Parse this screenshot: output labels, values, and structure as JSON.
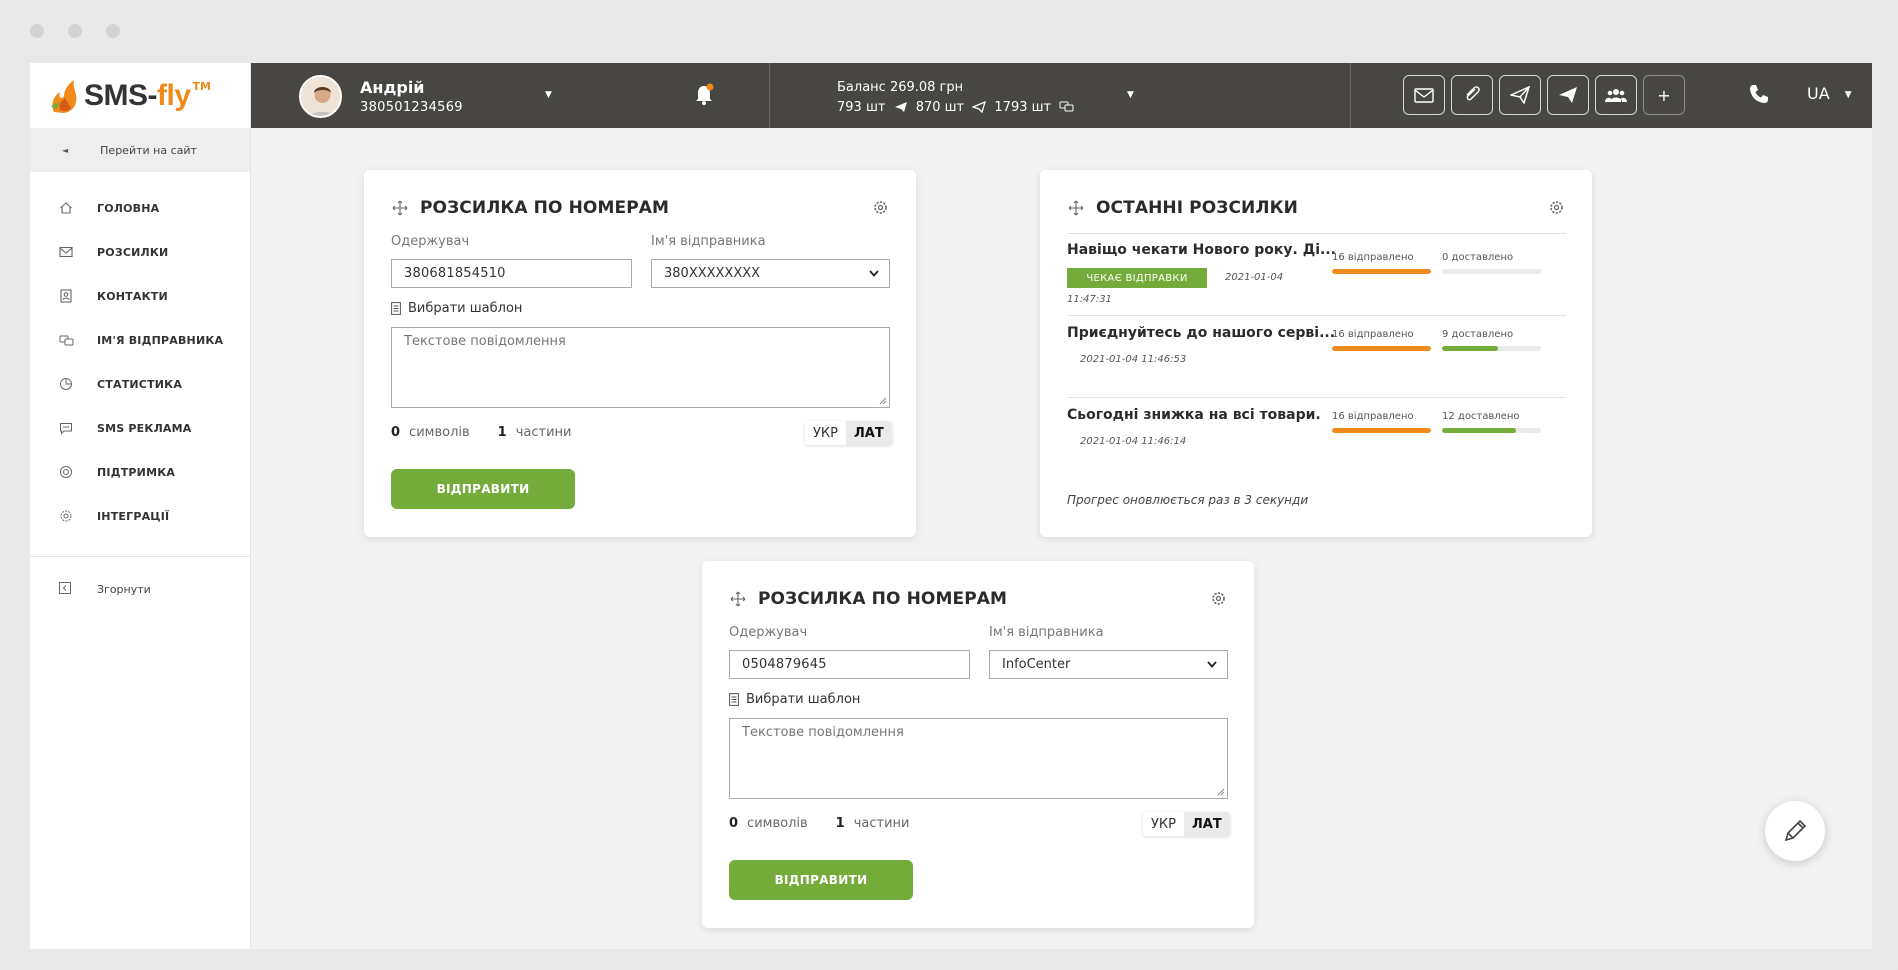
{
  "brand": {
    "logo_sms": "SMS-",
    "logo_fly": "fly",
    "logo_tm": "TM"
  },
  "sidebar": {
    "goto_site": "Перейти на сайт",
    "items": [
      {
        "label": "ГОЛОВНА",
        "icon": "home-icon"
      },
      {
        "label": "РОЗСИЛКИ",
        "icon": "envelope-icon"
      },
      {
        "label": "КОНТАКТИ",
        "icon": "contacts-icon"
      },
      {
        "label": "ІМ'Я ВІДПРАВНИКА",
        "icon": "sender-icon"
      },
      {
        "label": "СТАТИСТИКА",
        "icon": "pie-chart-icon"
      },
      {
        "label": "SMS РЕКЛАМА",
        "icon": "ad-message-icon"
      },
      {
        "label": "ПІДТРИМКА",
        "icon": "support-icon"
      },
      {
        "label": "ІНТЕГРАЦІЇ",
        "icon": "gear-icon"
      }
    ],
    "collapse": "Згорнути"
  },
  "topbar": {
    "user_name": "Андрій",
    "user_phone": "380501234569",
    "balance_line": "Баланс 269.08 грн",
    "sms_count": "793 шт",
    "telegram_count": "870 шт",
    "viber_count": "1793 шт",
    "lang": "UA",
    "tools": [
      "envelope-icon",
      "paperclip-icon",
      "send-outline-icon",
      "telegram-icon",
      "group-icon",
      "plus-icon"
    ],
    "plus_label": "+"
  },
  "card1": {
    "title": "РОЗСИЛКА ПО НОМЕРАМ",
    "recipient_label": "Одержувач",
    "recipient_value": "380681854510",
    "sender_label": "Ім'я відправника",
    "sender_value": "380XXXXXXXX",
    "template_label": "Вибрати шаблон",
    "message_placeholder": "Текстове повідомлення",
    "chars_count": "0",
    "chars_label": "символів",
    "parts_count": "1",
    "parts_label": "частини",
    "layout_ukr": "УКР",
    "layout_lat": "ЛАТ",
    "send_label": "ВІДПРАВИТИ"
  },
  "card2": {
    "title": "РОЗСИЛКА ПО НОМЕРАМ",
    "recipient_label": "Одержувач",
    "recipient_value": "0504879645",
    "sender_label": "Ім'я відправника",
    "sender_value": "InfoCenter",
    "template_label": "Вибрати шаблон",
    "message_placeholder": "Текстове повідомлення",
    "chars_count": "0",
    "chars_label": "символів",
    "parts_count": "1",
    "parts_label": "частини",
    "layout_ukr": "УКР",
    "layout_lat": "ЛАТ",
    "send_label": "ВІДПРАВИТИ"
  },
  "recent": {
    "title": "ОСТАННІ РОЗСИЛКИ",
    "items": [
      {
        "title": "Навіщо чекати Нового року. Ді...",
        "badge": "ЧЕКАЄ ВІДПРАВКИ",
        "date": "2021-01-04",
        "time": "11:47:31",
        "sent_label": "16 відправлено",
        "delivered_label": "0 доставлено",
        "sent_progress": 1.0,
        "delivered_progress": 0.0
      },
      {
        "title": "Приєднуйтесь до нашого серві...",
        "date": "2021-01-04 11:46:53",
        "sent_label": "16 відправлено",
        "delivered_label": "9 доставлено",
        "sent_progress": 1.0,
        "delivered_progress": 0.5625
      },
      {
        "title": "Сьогодні знижка на всі товари.",
        "date": "2021-01-04 11:46:14",
        "sent_label": "16 відправлено",
        "delivered_label": "12 доставлено",
        "sent_progress": 1.0,
        "delivered_progress": 0.75
      }
    ],
    "note": "Прогрес оновлюється раз в 3 секунди"
  },
  "colors": {
    "topbar": "#474643",
    "accent_green": "#74ac3b",
    "accent_orange": "#f08a1a",
    "sent_bar": "#f08a1a",
    "delivered_bar": "#74ac3b"
  }
}
